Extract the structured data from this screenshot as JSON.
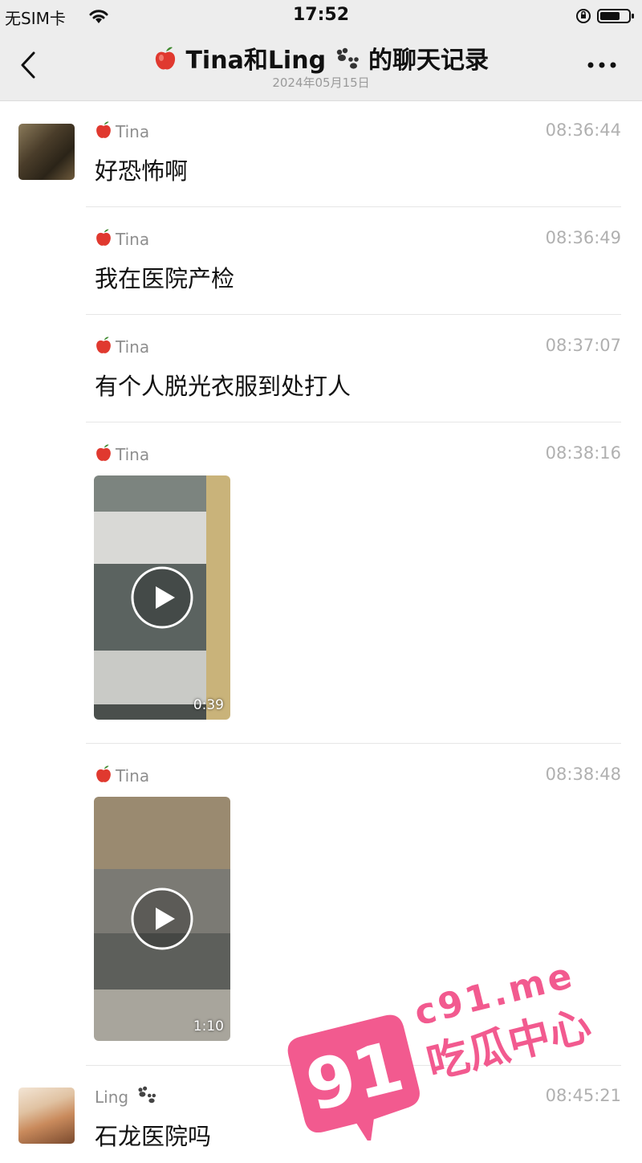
{
  "status_bar": {
    "carrier": "无SIM卡",
    "time": "17:52",
    "icons": [
      "wifi-icon",
      "orientation-lock-icon",
      "battery-icon"
    ]
  },
  "header": {
    "title": "Tina和Ling",
    "title_suffix": "的聊天记录",
    "date": "2024年05月15日",
    "title_emojis": [
      "apple-icon",
      "paw-icon"
    ]
  },
  "messages": [
    {
      "sender": "Tina",
      "time": "08:36:44",
      "text": "好恐怖啊"
    },
    {
      "sender": "Tina",
      "time": "08:36:49",
      "text": "我在医院产检"
    },
    {
      "sender": "Tina",
      "time": "08:37:07",
      "text": "有个人脱光衣服到处打人"
    },
    {
      "sender": "Tina",
      "time": "08:38:16",
      "video_duration": "0:39"
    },
    {
      "sender": "Tina",
      "time": "08:38:48",
      "video_duration": "1:10"
    },
    {
      "sender": "Ling",
      "time": "08:45:21",
      "text": "石龙医院吗"
    }
  ],
  "watermark": {
    "number": "91",
    "domain": "c91.me",
    "label": "吃瓜中心",
    "color": "#f25a8f"
  },
  "colors": {
    "header_bg": "#ededed",
    "timestamp": "#b0b0b0",
    "sender": "#8f8f8f"
  }
}
